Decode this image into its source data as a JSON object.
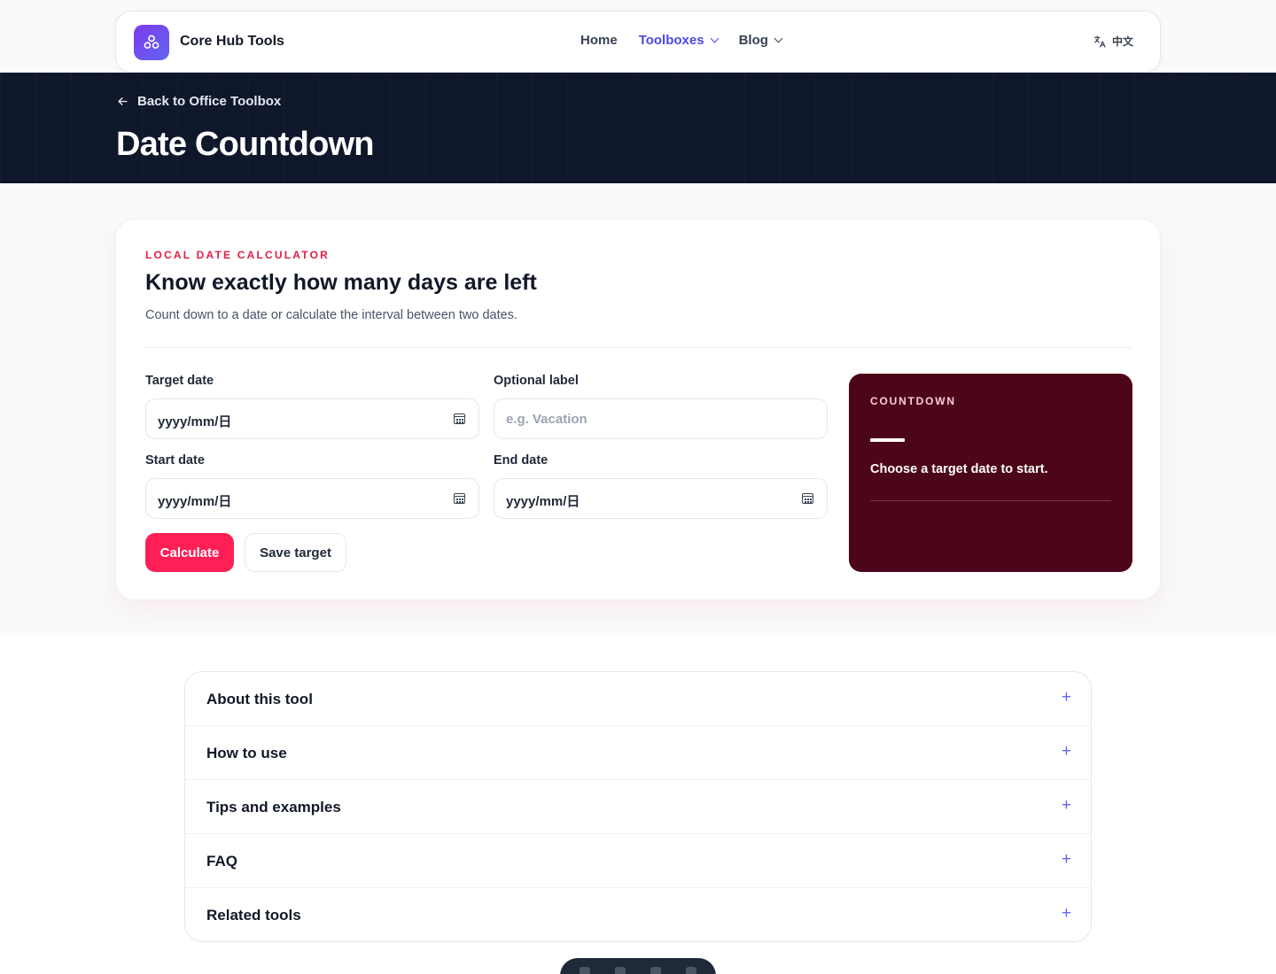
{
  "header": {
    "brand": "Core Hub Tools",
    "nav": [
      {
        "label": "Home",
        "active": false,
        "dropdown": false
      },
      {
        "label": "Toolboxes",
        "active": true,
        "dropdown": true
      },
      {
        "label": "Blog",
        "active": false,
        "dropdown": true
      }
    ],
    "language": "中文"
  },
  "hero": {
    "back_link": "Back to Office Toolbox",
    "title": "Date Countdown"
  },
  "card": {
    "eyebrow": "LOCAL DATE CALCULATOR",
    "title": "Know exactly how many days are left",
    "description": "Count down to a date or calculate the interval between two dates.",
    "fields": {
      "target_date": {
        "label": "Target date",
        "value": "yyyy/mm/日"
      },
      "optional_label": {
        "label": "Optional label",
        "placeholder": "e.g. Vacation"
      },
      "start_date": {
        "label": "Start date",
        "value": "yyyy/mm/日"
      },
      "end_date": {
        "label": "End date",
        "value": "yyyy/mm/日"
      }
    },
    "buttons": {
      "calculate": "Calculate",
      "save": "Save target"
    },
    "result": {
      "eyebrow": "COUNTDOWN",
      "message": "Choose a target date to start."
    }
  },
  "accordion": [
    {
      "label": "About this tool"
    },
    {
      "label": "How to use"
    },
    {
      "label": "Tips and examples"
    },
    {
      "label": "FAQ"
    },
    {
      "label": "Related tools"
    }
  ],
  "colors": {
    "accent": "#4f46e5",
    "primary_button": "#ff1f57",
    "eyebrow": "#e11d48",
    "hero_bg": "#0f172a",
    "result_panel": "#4c0519"
  },
  "icons": [
    "logo-icon",
    "translate-icon",
    "arrow-left-icon",
    "calendar-icon",
    "plus-icon"
  ]
}
